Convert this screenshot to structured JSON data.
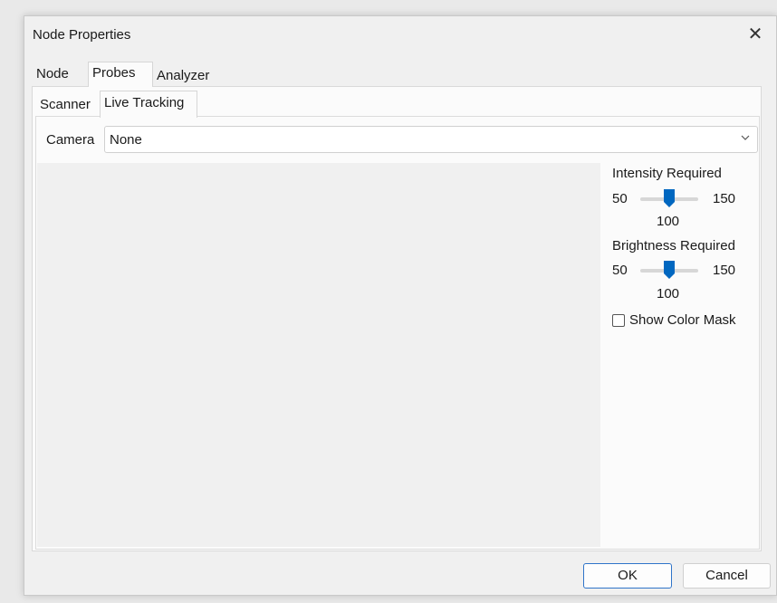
{
  "window": {
    "title": "Node Properties",
    "close_glyph": "✕"
  },
  "tabs": [
    {
      "label": "Node",
      "active": false
    },
    {
      "label": "Probes",
      "active": true
    },
    {
      "label": "Analyzer",
      "active": false
    }
  ],
  "subtabs": [
    {
      "label": "Scanner",
      "active": false
    },
    {
      "label": "Live Tracking",
      "active": true
    }
  ],
  "camera": {
    "label": "Camera",
    "value": "None",
    "icon": "chevron-down-icon"
  },
  "intensity": {
    "label": "Intensity Required",
    "min": "50",
    "max": "150",
    "value": "100"
  },
  "brightness": {
    "label": "Brightness Required",
    "min": "50",
    "max": "150",
    "value": "100"
  },
  "color_mask": {
    "label": "Show Color Mask",
    "checked": false
  },
  "buttons": {
    "ok": "OK",
    "cancel": "Cancel"
  },
  "colors": {
    "accent": "#0067c0",
    "ok_border": "#2f74c9"
  }
}
